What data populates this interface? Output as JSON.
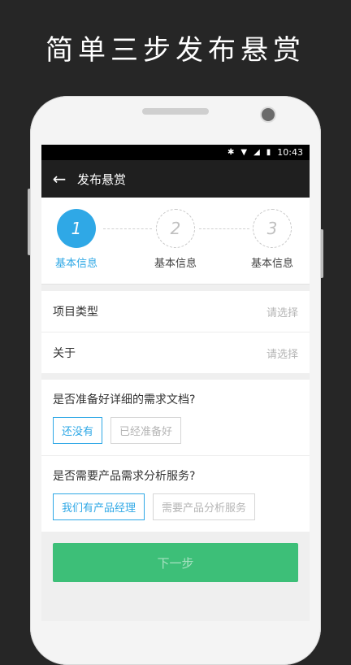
{
  "promo": {
    "title": "简单三步发布悬赏"
  },
  "statusbar": {
    "time": "10:43"
  },
  "appbar": {
    "title": "发布悬赏"
  },
  "stepper": {
    "steps": [
      {
        "number": "1",
        "label": "基本信息",
        "active": true
      },
      {
        "number": "2",
        "label": "基本信息",
        "active": false
      },
      {
        "number": "3",
        "label": "基本信息",
        "active": false
      }
    ]
  },
  "form": {
    "project_type": {
      "label": "项目类型",
      "placeholder": "请选择"
    },
    "about": {
      "label": "关于",
      "placeholder": "请选择"
    }
  },
  "questions": [
    {
      "text": "是否准备好详细的需求文档?",
      "options": [
        "还没有",
        "已经准备好"
      ],
      "selected": 0
    },
    {
      "text": "是否需要产品需求分析服务?",
      "options": [
        "我们有产品经理",
        "需要产品分析服务"
      ],
      "selected": 0
    }
  ],
  "next_button": {
    "label": "下一步"
  },
  "colors": {
    "accent": "#2fa8e6",
    "primary_button": "#3dbf78",
    "appbar": "#1f1f1f"
  }
}
